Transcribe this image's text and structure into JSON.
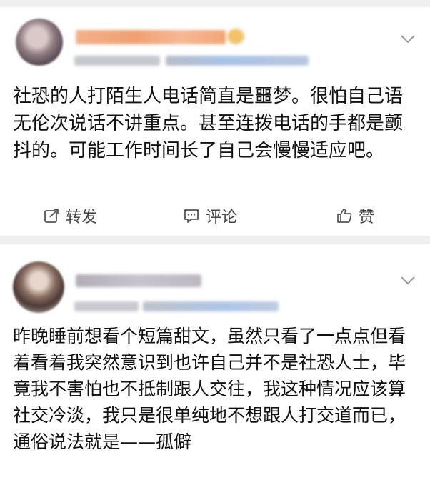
{
  "colors": {
    "separator": "#efefef",
    "text": "#111111",
    "action_text": "#444444",
    "username_blur_1": "#f2a070",
    "username_blur_2": "#b9b4bd",
    "meta_blur": "#b9bcc7",
    "meta_blur_link": "#a9c3e6"
  },
  "post1": {
    "content": "社恐的人打陌生人电话简直是噩梦。很怕自己语无伦次说话不讲重点。甚至连拨电话的手都是颤抖的。可能工作时间长了自己会慢慢适应吧。",
    "actions": {
      "repost": "转发",
      "comment": "评论",
      "like": "赞"
    },
    "icons": {
      "repost": "share-icon",
      "comment": "comment-icon",
      "like": "thumbs-up-icon",
      "menu": "chevron-down-icon"
    }
  },
  "post2": {
    "content": "昨晚睡前想看个短篇甜文，虽然只看了一点点但看着看着我突然意识到也许自己并不是社恐人士，毕竟我不害怕也不抵制跟人交往，我这种情况应该算社交冷淡，我只是很单纯地不想跟人打交道而已，通俗说法就是——孤僻",
    "icons": {
      "menu": "chevron-down-icon"
    }
  }
}
